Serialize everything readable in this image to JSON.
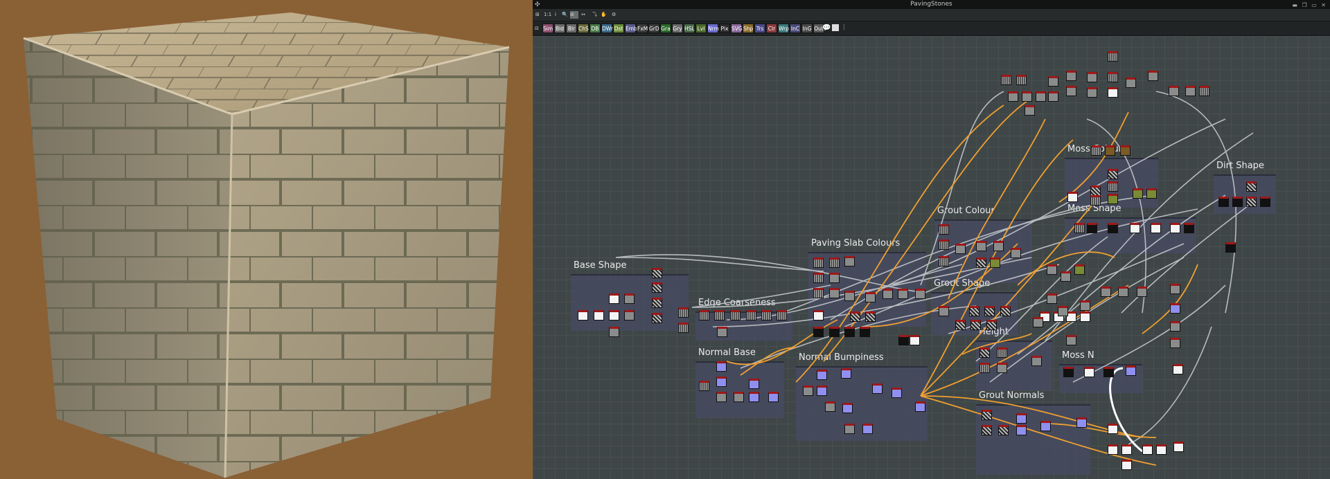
{
  "window": {
    "title": "PavingStones"
  },
  "toolbar": {
    "zoom_label": "1:1",
    "items": [
      "1:1",
      "i",
      "🔍",
      "⊞",
      "↔",
      "⤵",
      "✋",
      "⚙"
    ]
  },
  "node_palette": [
    {
      "label": "Sim",
      "color": "#8a4f6f"
    },
    {
      "label": "Bld",
      "color": "#6a6a6a"
    },
    {
      "label": "Blr",
      "color": "#6a6a6a"
    },
    {
      "label": "ChS",
      "color": "#6a6a3a"
    },
    {
      "label": "DB",
      "color": "#4a7a4a"
    },
    {
      "label": "DWr",
      "color": "#3a6a8a"
    },
    {
      "label": "Dst",
      "color": "#6a8a3a"
    },
    {
      "label": "Emb",
      "color": "#5a5a8a"
    },
    {
      "label": "FxM",
      "color": "#3a3a3a"
    },
    {
      "label": "GrD",
      "color": "#3a3a3a"
    },
    {
      "label": "Gra",
      "color": "#2a6a2a"
    },
    {
      "label": "Gry",
      "color": "#6a6a6a"
    },
    {
      "label": "HSL",
      "color": "#4a6a4a"
    },
    {
      "label": "Lvl",
      "color": "#4a6a2a"
    },
    {
      "label": "Nrm",
      "color": "#6a6acc"
    },
    {
      "label": "Pix",
      "color": "#2a2a2a"
    },
    {
      "label": "SVG",
      "color": "#8a6a9a"
    },
    {
      "label": "Shp",
      "color": "#8a6a2a"
    },
    {
      "label": "Trs",
      "color": "#4a4a8a"
    },
    {
      "label": "Clr",
      "color": "#8a3a3a"
    },
    {
      "label": "Wrp",
      "color": "#3a7a7a"
    },
    {
      "label": "InC",
      "color": "#4a4a7a"
    },
    {
      "label": "InG",
      "color": "#4a4a4a"
    },
    {
      "label": "Out",
      "color": "#5a5a5a"
    }
  ],
  "frames": {
    "base_shape": "Base Shape",
    "edge_coarseness": "Edge Coarseness",
    "normal_base": "Normal Base",
    "paving_slab_colours": "Paving Slab Colours",
    "normal_bumpiness": "Normal Bumpiness",
    "grout_colour": "Grout Colour",
    "grout_shape": "Grout Shape",
    "height": "Height",
    "grout_normals": "Grout Normals",
    "moss_colour": "Moss Colour",
    "moss_shape": "Moss Shape",
    "moss_n": "Moss N",
    "dirt_shape": "Dirt Shape"
  },
  "colors": {
    "viewport_bg": "#8a6035",
    "graph_bg": "#3f4647",
    "frame_bg": "#464a60",
    "wire_orange": "#f0a030",
    "wire_gray": "#b8bcc0",
    "wire_white": "#ffffff"
  }
}
